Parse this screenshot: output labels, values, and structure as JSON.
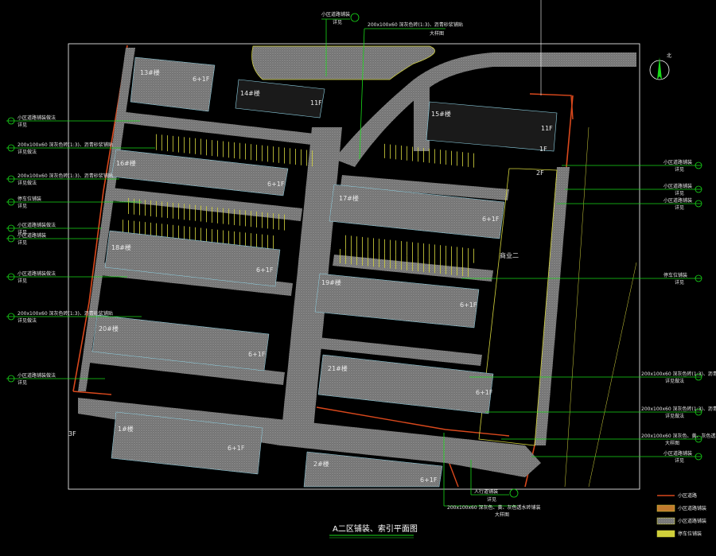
{
  "drawing": {
    "title": "A二区铺装、索引平面图",
    "north_label": "北"
  },
  "buildings": [
    {
      "id": "13#",
      "label": "13#楼",
      "floors": "6+1F"
    },
    {
      "id": "14#",
      "label": "14#楼",
      "floors": "11F"
    },
    {
      "id": "15#",
      "label": "15#楼",
      "floors": "11F"
    },
    {
      "id": "16#",
      "label": "16#楼",
      "floors": "6+1F"
    },
    {
      "id": "17#",
      "label": "17#楼",
      "floors": "6+1F"
    },
    {
      "id": "18#",
      "label": "18#楼",
      "floors": "6+1F"
    },
    {
      "id": "19#",
      "label": "19#楼",
      "floors": "6+1F"
    },
    {
      "id": "20#",
      "label": "20#楼",
      "floors": "6+1F"
    },
    {
      "id": "21#",
      "label": "21#楼",
      "floors": "6+1F"
    },
    {
      "id": "1#",
      "label": "1#楼",
      "floors": "6+1F"
    },
    {
      "id": "2#",
      "label": "2#楼",
      "floors": "6+1F"
    }
  ],
  "misc_labels": {
    "commercial": "商业二",
    "floors_2f": "2F",
    "floors_1f": "1F",
    "floors_3f": "3F"
  },
  "callouts": {
    "top_a": "小区道路铺装",
    "top_a_sub": "详见",
    "top_b": "200x100x60 深灰色砖(1:3)、沥青砂浆铺贴",
    "top_b_sub": "大样图",
    "left": [
      {
        "text": "小区道路铺装做法",
        "sub": "详见"
      },
      {
        "text": "200x100x60 深灰色砖(1:3)、沥青砂浆铺贴",
        "sub": "详见做法"
      },
      {
        "text": "200x100x60 深灰色砖(1:3)、沥青砂浆铺贴",
        "sub": "详见做法"
      },
      {
        "text": "停车位铺装",
        "sub": "详见"
      },
      {
        "text": "小区道路铺装做法",
        "sub": "详见"
      },
      {
        "text": "小区道路铺装",
        "sub": "详见"
      },
      {
        "text": "小区道路铺装做法",
        "sub": "详见"
      },
      {
        "text": "200x100x60 深灰色砖(1:3)、沥青砂浆铺贴",
        "sub": "详见做法"
      },
      {
        "text": "小区道路铺装做法",
        "sub": "详见"
      }
    ],
    "right": [
      {
        "text": "小区道路铺装",
        "sub": "详见"
      },
      {
        "text": "小区道路铺装",
        "sub": "详见"
      },
      {
        "text": "小区道路铺装",
        "sub": "详见"
      },
      {
        "text": "停车位铺装",
        "sub": "详见"
      },
      {
        "text": "200x100x60 深灰色砖(1:3)、沥青砂浆铺贴",
        "sub": "详见做法"
      },
      {
        "text": "200x100x60 深灰色砖(1:3)、沥青砂浆铺贴",
        "sub": "详见做法"
      },
      {
        "text": "200x100x60 深灰色、黄、灰色透水砖铺装",
        "sub": "大样图"
      },
      {
        "text": "小区道路铺装",
        "sub": "详见"
      }
    ],
    "bottom_a": "人行道铺装",
    "bottom_a_sub": "详见",
    "bottom_b": "200x100x60 深灰色、黄、灰色透水砖铺装",
    "bottom_b_sub": "大样图"
  },
  "legend": [
    {
      "label": "小区道路",
      "color": "#d9481c"
    },
    {
      "label": "小区道路铺装",
      "color": "#c07a2e"
    },
    {
      "label": "小区道路铺装",
      "color": "#a9a9a9"
    },
    {
      "label": "停车位铺装",
      "color": "#cfcf3a"
    }
  ],
  "colors": {
    "background": "#000000",
    "leader": "#19d919",
    "paving": "#8c8c8c",
    "building": "#bdbdbd",
    "curb": "#d4d43c",
    "boundary": "#d9481c",
    "frame": "#ffffff"
  }
}
